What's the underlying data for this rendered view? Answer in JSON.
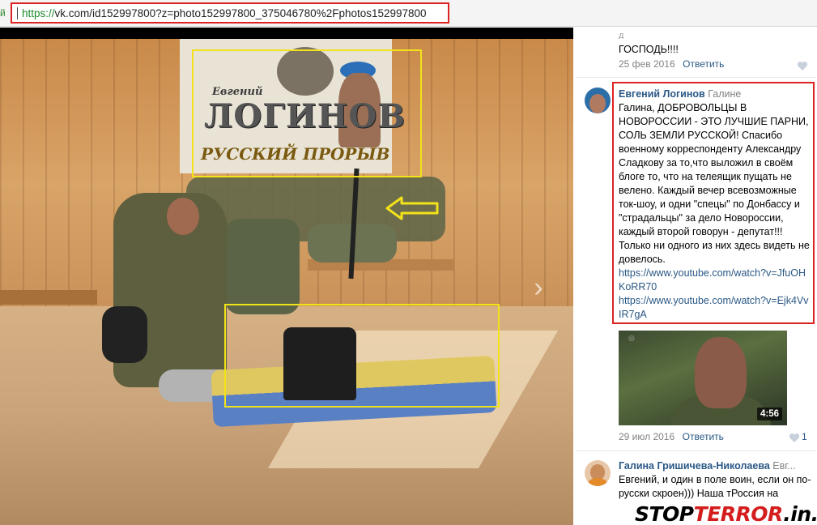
{
  "browser": {
    "url_protocol": "https://",
    "url_rest": "vk.com/id152997800?z=photo152997800_375046780%2Fphotos152997800",
    "edge_mark": "й"
  },
  "photo": {
    "banner_first_name": "Евгений",
    "banner_last_name": "ЛОГИНОВ",
    "banner_slogan": "РУССКИЙ ПРОРЫВ",
    "next_arrow": "›",
    "colors": {
      "annotation_box": "#f2e21a",
      "annotation_highlight": "#dd2222"
    }
  },
  "comments": [
    {
      "text_tail": "ГОСПОДЬ!!!!",
      "date": "25 фев 2016",
      "reply_label": "Ответить",
      "icon": "heart-icon"
    },
    {
      "author": "Евгений Логинов",
      "to": "Галине",
      "text": "Галина, ДОБРОВОЛЬЦЫ В НОВОРОССИИ - ЭТО ЛУЧШИЕ ПАРНИ, СОЛЬ ЗЕМЛИ РУССКОЙ! Спасибо военному корреспонденту Александру Сладкову за то,что выложил в своём блоге то, что на телеящик пущать не велено. Каждый вечер всевозможные ток-шоу, и одни \"спецы\" по Донбассу и \"страдальцы\" за дело Новороссии, каждый второй говорун - депутат!!! Только ни одного из них здесь видеть не довелось.",
      "links": [
        "https://www.youtube.com/watch?v=JfuOHKoRR70",
        "https://www.youtube.com/watch?v=Ejk4VvIR7gA"
      ],
      "video_duration": "4:56",
      "date": "29 июл 2016",
      "reply_label": "Ответить",
      "likes": "1",
      "icon": "heart-icon"
    },
    {
      "author": "Галина Гришичева-Николаева",
      "to": "Евг...",
      "text": "Евгений, и один в поле воин, если он по-русски скроен))) Наша тРоссия на"
    }
  ],
  "watermark": {
    "part1": "STOP",
    "part2": "TERROR",
    "part3": ".in.ua"
  }
}
